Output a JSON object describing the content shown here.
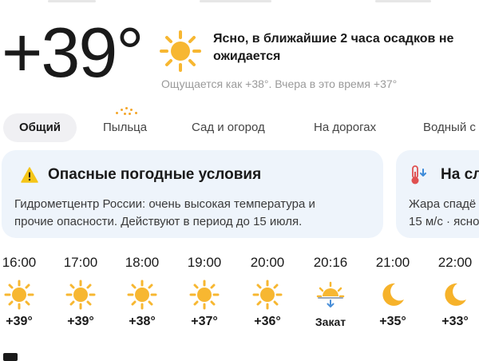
{
  "current": {
    "temperature": "+39°",
    "icon": "sun-icon",
    "condition_line1": "Ясно, в ближайшие 2 часа осадков не",
    "condition_line2": "ожидается",
    "feels_like": "Ощущается как +38°. Вчера в это время +37°"
  },
  "tabs": [
    {
      "label": "Общий",
      "active": true
    },
    {
      "label": "Пыльца"
    },
    {
      "label": "Сад и огород"
    },
    {
      "label": "На дорогах"
    },
    {
      "label": "Водный с"
    }
  ],
  "alerts": [
    {
      "icon": "warning-icon",
      "title": "Опасные погодные условия",
      "text_line1": "Гидрометцентр России: очень высокая температура и",
      "text_line2": "прочие опасности. Действуют в период до 15 июля."
    },
    {
      "icon": "thermometer-icon",
      "title": "На сл",
      "text_line1": "Жара спадё",
      "text_line2": "15 м/с · ясно"
    }
  ],
  "hourly": [
    {
      "time": "16:00",
      "icon": "sun-icon",
      "value": "+39°"
    },
    {
      "time": "17:00",
      "icon": "sun-icon",
      "value": "+39°"
    },
    {
      "time": "18:00",
      "icon": "sun-icon",
      "value": "+38°"
    },
    {
      "time": "19:00",
      "icon": "sun-icon",
      "value": "+37°"
    },
    {
      "time": "20:00",
      "icon": "sun-icon",
      "value": "+36°"
    },
    {
      "time": "20:16",
      "icon": "sunset-icon",
      "value": "Закат"
    },
    {
      "time": "21:00",
      "icon": "moon-icon",
      "value": "+35°"
    },
    {
      "time": "22:00",
      "icon": "moon-icon",
      "value": "+33°"
    }
  ],
  "colors": {
    "sun": "#f7b731",
    "moon": "#f6b22a",
    "card_background": "#eef4fb",
    "active_tab_background": "#f0f0f3",
    "warning": "#f5c518",
    "muted_text": "#9a9a9a"
  }
}
